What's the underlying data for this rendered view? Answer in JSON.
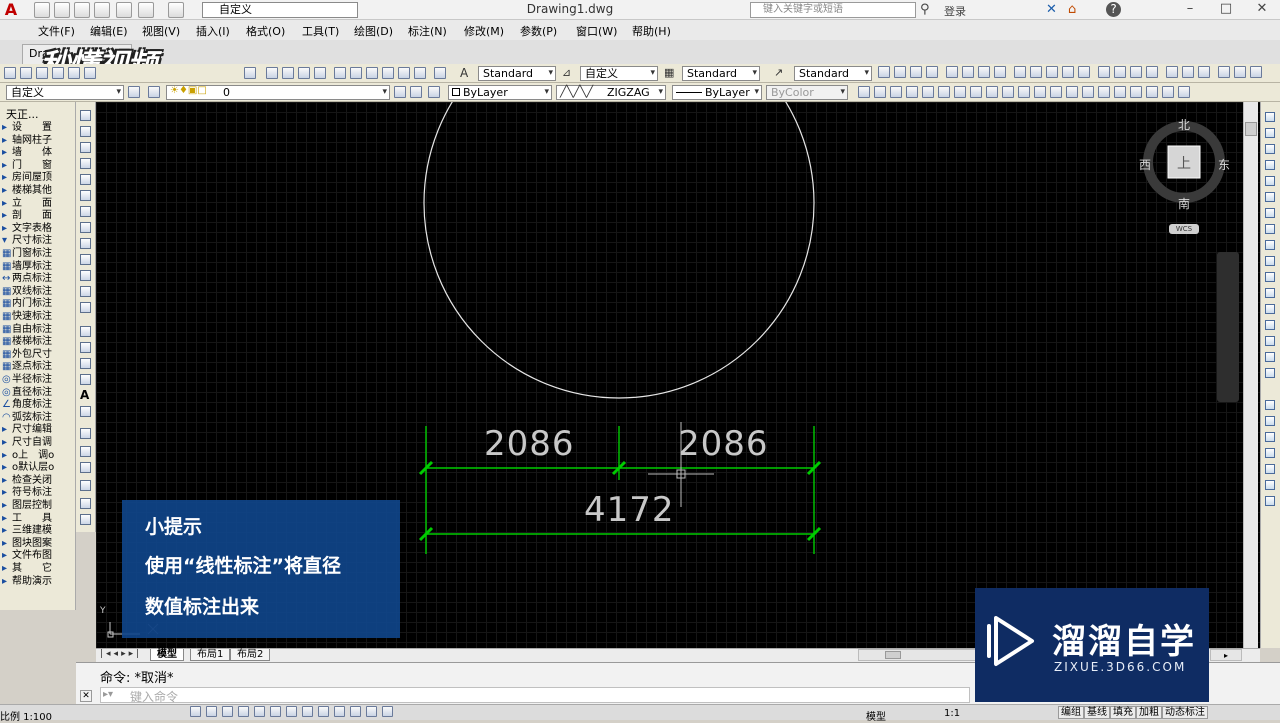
{
  "titlebar": {
    "workspace": "自定义",
    "doc_title": "Drawing1.dwg",
    "search_placeholder": "键入关键字或短语",
    "login": "登录"
  },
  "menu": [
    "文件(F)",
    "编辑(E)",
    "视图(V)",
    "插入(I)",
    "格式(O)",
    "工具(T)",
    "绘图(D)",
    "标注(N)",
    "修改(M)",
    "参数(P)",
    "窗口(W)",
    "帮助(H)"
  ],
  "doc_tab": "Drawi",
  "watermark": "秒懂视频",
  "toolbar1": {
    "text_style": "Standard",
    "dim_style": "自定义",
    "table_style": "Standard",
    "mleader_style": "Standard"
  },
  "toolbar2": {
    "workspace": "自定义",
    "layer": "0",
    "color": "ByLayer",
    "linetype": "ZIGZAG",
    "lineweight": "ByLayer",
    "plotstyle": "ByColor"
  },
  "left_panel": {
    "title": "天正...",
    "items": [
      {
        "glyph": "▸",
        "label": "设　　置"
      },
      {
        "glyph": "▸",
        "label": "轴网柱子"
      },
      {
        "glyph": "▸",
        "label": "墙　　体"
      },
      {
        "glyph": "▸",
        "label": "门　　窗"
      },
      {
        "glyph": "▸",
        "label": "房间屋顶"
      },
      {
        "glyph": "▸",
        "label": "楼梯其他"
      },
      {
        "glyph": "▸",
        "label": "立　　面"
      },
      {
        "glyph": "▸",
        "label": "剖　　面"
      },
      {
        "glyph": "▸",
        "label": "文字表格"
      },
      {
        "glyph": "▾",
        "label": "尺寸标注"
      },
      {
        "glyph": "▦",
        "label": "门窗标注"
      },
      {
        "glyph": "▦",
        "label": "墙厚标注"
      },
      {
        "glyph": "↔",
        "label": "两点标注"
      },
      {
        "glyph": "▦",
        "label": "双线标注"
      },
      {
        "glyph": "▦",
        "label": "内门标注"
      },
      {
        "glyph": "▦",
        "label": "快速标注"
      },
      {
        "glyph": "▦",
        "label": "自由标注"
      },
      {
        "glyph": "▦",
        "label": "楼梯标注"
      },
      {
        "glyph": "▦",
        "label": "外包尺寸"
      },
      {
        "glyph": "▦",
        "label": "逐点标注"
      },
      {
        "glyph": "◎",
        "label": "半径标注"
      },
      {
        "glyph": "◎",
        "label": "直径标注"
      },
      {
        "glyph": "∠",
        "label": "角度标注"
      },
      {
        "glyph": "◠",
        "label": "弧弦标注"
      },
      {
        "glyph": "▸",
        "label": "尺寸编辑"
      },
      {
        "glyph": "▸",
        "label": "尺寸自调"
      },
      {
        "glyph": "▸",
        "label": "o上　调o"
      },
      {
        "glyph": "▸",
        "label": "o默认层o"
      },
      {
        "glyph": "▸",
        "label": "检查关闭"
      },
      {
        "glyph": "▸",
        "label": "符号标注"
      },
      {
        "glyph": "▸",
        "label": "图层控制"
      },
      {
        "glyph": "▸",
        "label": "工　　具"
      },
      {
        "glyph": "▸",
        "label": "三维建模"
      },
      {
        "glyph": "▸",
        "label": "图块图案"
      },
      {
        "glyph": "▸",
        "label": "文件布图"
      },
      {
        "glyph": "▸",
        "label": "其　　它"
      },
      {
        "glyph": "▸",
        "label": "帮助演示"
      }
    ]
  },
  "drawing": {
    "dim_left": "2086",
    "dim_right": "2086",
    "dim_total": "4172"
  },
  "viewcube": {
    "north": "北",
    "south": "南",
    "east": "东",
    "west": "西",
    "face": "上",
    "wcs": "WCS"
  },
  "layout_tabs": [
    "模型",
    "布局1",
    "布局2"
  ],
  "tip": {
    "title": "小提示",
    "line1": "使用“线性标注”将直径",
    "line2": "数值标注出来"
  },
  "command": {
    "history": "命令: *取消*",
    "prompt": "键入命令"
  },
  "status": {
    "scale": "比例 1:100",
    "model": "模型",
    "anno_scale": "1:1",
    "buttons": [
      "编组",
      "基线",
      "填充",
      "加粗",
      "动态标注"
    ]
  },
  "brand": {
    "name": "溜溜自学",
    "url": "ZIXUE.3D66.COM"
  },
  "colors": {
    "canvas": "#000000",
    "dimension": "#00cc00",
    "dim_text": "#c8c8c8",
    "circle": "#e6e6e6",
    "tip_bg": "#10468c",
    "brand_bg": "#0f2c63"
  }
}
